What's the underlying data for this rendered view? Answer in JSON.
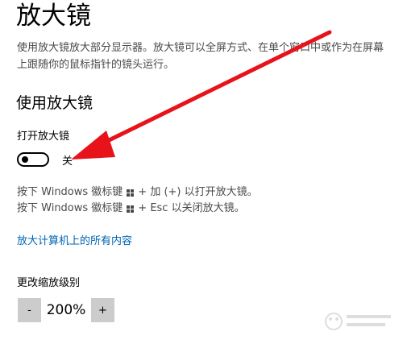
{
  "page": {
    "title": "放大镜",
    "description": "使用放大镜放大部分显示器。放大镜可以全屏方式、在单个窗口中或作为在屏幕上跟随你的鼠标指针的镜头运行。"
  },
  "use_section": {
    "heading": "使用放大镜",
    "toggle_label": "打开放大镜",
    "toggle_state": "关",
    "toggle_on": false
  },
  "shortcuts": {
    "open": {
      "prefix": "按下 Windows 徽标键",
      "suffix": "+ 加 (+) 以打开放大镜。"
    },
    "close": {
      "prefix": "按下 Windows 徽标键",
      "suffix": "+ Esc 以关闭放大镜。"
    },
    "icon": "windows-logo-icon"
  },
  "link": {
    "label": "放大计算机上的所有内容"
  },
  "zoom": {
    "label": "更改缩放级别",
    "decrease": "-",
    "value": "200%",
    "increase": "+"
  },
  "annotation": {
    "arrow_color": "#e8131a",
    "icon": "red-arrow-annotation"
  },
  "colors": {
    "link": "#0063b1",
    "secondary_text": "#4a4a4a",
    "button_bg": "#cccccc"
  }
}
